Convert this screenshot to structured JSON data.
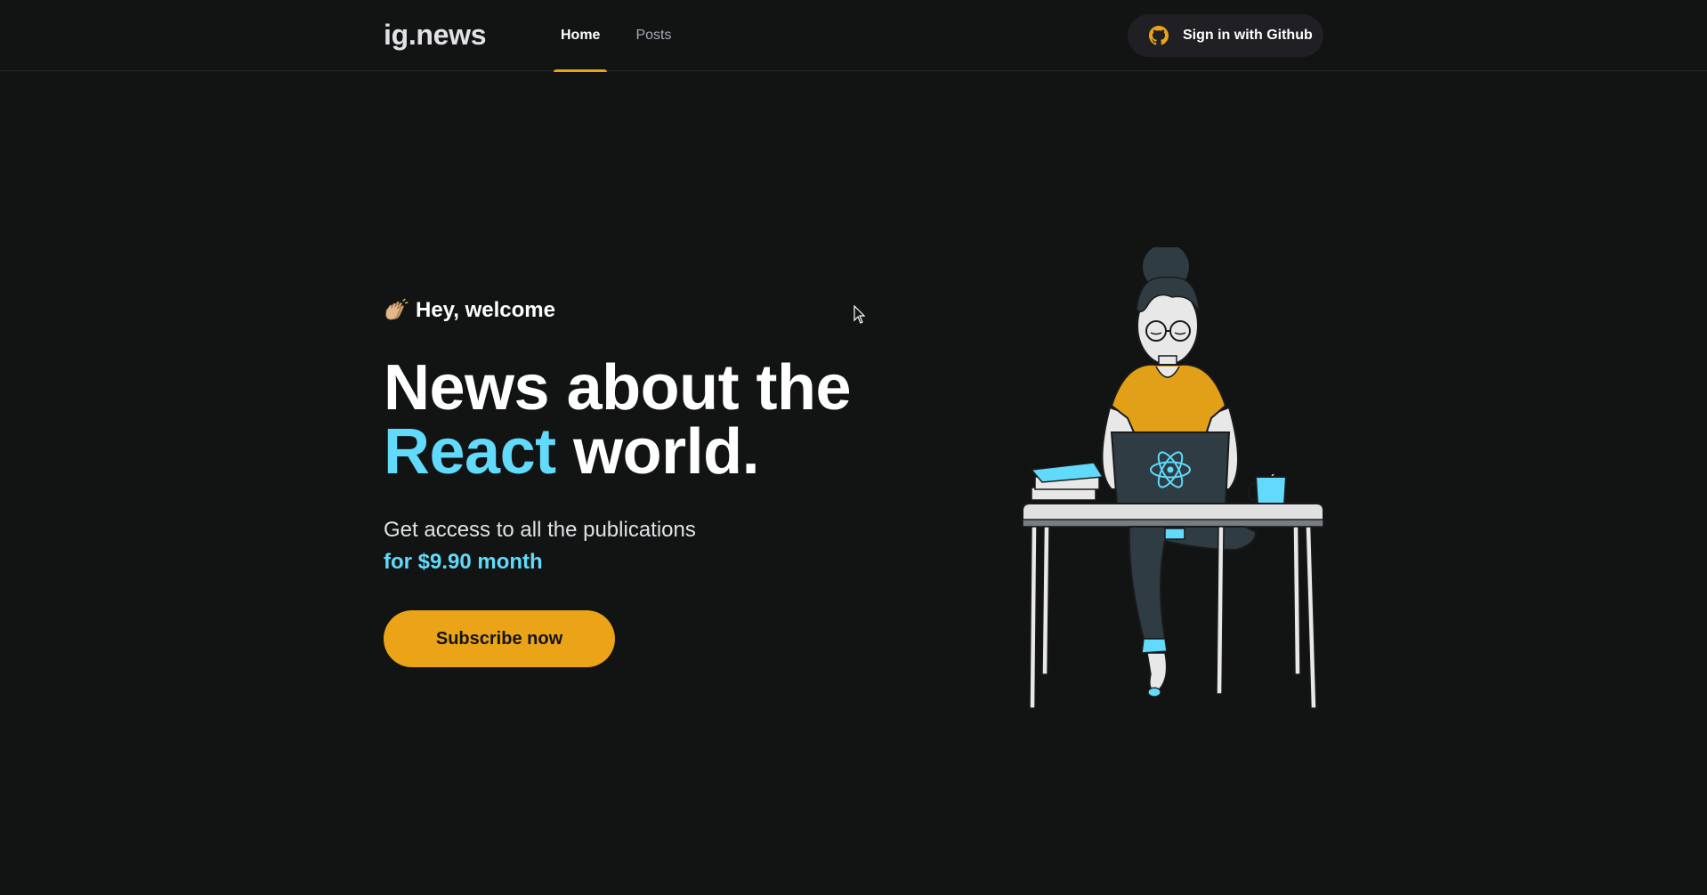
{
  "header": {
    "logo": "ig.news",
    "nav": [
      {
        "label": "Home",
        "active": true
      },
      {
        "label": "Posts",
        "active": false
      }
    ],
    "signin_label": "Sign in with Github",
    "signin_icon": "github-icon"
  },
  "hero": {
    "welcome_icon": "clapping-hands-icon",
    "welcome_text": "Hey, welcome",
    "headline_line1": "News about the",
    "headline_accent": "React",
    "headline_line2_rest": "world.",
    "subtitle": "Get access to all the publications",
    "price": "for $9.90 month",
    "subscribe_label": "Subscribe now",
    "illustration": "woman-at-laptop-illustration"
  },
  "colors": {
    "background": "#121414",
    "accent_yellow": "#eba417",
    "accent_cyan": "#61dafb",
    "button_dark": "#202024"
  }
}
